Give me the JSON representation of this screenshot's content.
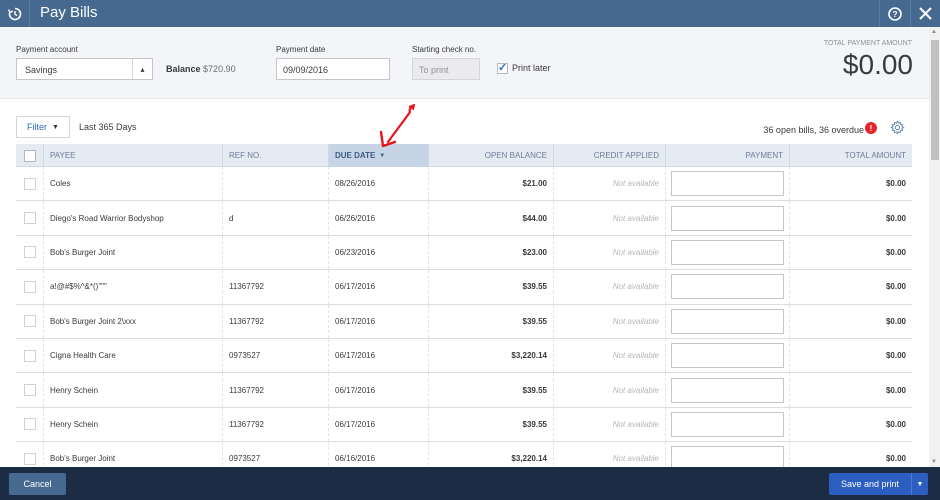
{
  "window": {
    "title": "Pay Bills",
    "icons": {
      "history": "history-icon",
      "help": "help-icon",
      "close": "close-icon"
    }
  },
  "header": {
    "payment_account_label": "Payment account",
    "payment_account_value": "Savings",
    "balance_label": "Balance",
    "balance_value": "$720.90",
    "payment_date_label": "Payment date",
    "payment_date_value": "09/09/2016",
    "starting_check_label": "Starting check no.",
    "starting_check_placeholder": "To print",
    "print_later_label": "Print later",
    "print_later_checked": true,
    "total_payment_label": "TOTAL PAYMENT AMOUNT",
    "total_payment_value": "$0.00"
  },
  "filter": {
    "button_label": "Filter",
    "range_label": "Last 365 Days",
    "summary": "36 open bills, 36 overdue"
  },
  "table": {
    "columns": [
      "PAYEE",
      "REF NO.",
      "DUE DATE",
      "OPEN BALANCE",
      "CREDIT APPLIED",
      "PAYMENT",
      "TOTAL AMOUNT"
    ],
    "sorted_column": "DUE DATE",
    "rows": [
      {
        "payee": "Coles",
        "ref": "",
        "due": "08/26/2016",
        "open": "$21.00",
        "credit": "Not available",
        "payment": "",
        "total": "$0.00"
      },
      {
        "payee": "Diego's Road Warrior Bodyshop",
        "ref": "d",
        "due": "06/26/2016",
        "open": "$44.00",
        "credit": "Not available",
        "payment": "",
        "total": "$0.00"
      },
      {
        "payee": "Bob's Burger Joint",
        "ref": "",
        "due": "06/23/2016",
        "open": "$23.00",
        "credit": "Not available",
        "payment": "",
        "total": "$0.00"
      },
      {
        "payee": "a!@#$%^&*()\"\"\"",
        "ref": "11367792",
        "due": "06/17/2016",
        "open": "$39.55",
        "credit": "Not available",
        "payment": "",
        "total": "$0.00"
      },
      {
        "payee": "Bob's Burger Joint 2\\xxx",
        "ref": "11367792",
        "due": "06/17/2016",
        "open": "$39.55",
        "credit": "Not available",
        "payment": "",
        "total": "$0.00"
      },
      {
        "payee": "Cigna Health Care",
        "ref": "0973527",
        "due": "06/17/2016",
        "open": "$3,220.14",
        "credit": "Not available",
        "payment": "",
        "total": "$0.00"
      },
      {
        "payee": "Henry Schein",
        "ref": "11367792",
        "due": "06/17/2016",
        "open": "$39.55",
        "credit": "Not available",
        "payment": "",
        "total": "$0.00"
      },
      {
        "payee": "Henry Schein",
        "ref": "11367792",
        "due": "06/17/2016",
        "open": "$39.55",
        "credit": "Not available",
        "payment": "",
        "total": "$0.00"
      },
      {
        "payee": "Bob's Burger Joint",
        "ref": "0973527",
        "due": "06/16/2016",
        "open": "$3,220.14",
        "credit": "Not available",
        "payment": "",
        "total": "$0.00"
      }
    ]
  },
  "footer": {
    "cancel_label": "Cancel",
    "save_label": "Save and print"
  },
  "colors": {
    "titlebar": "#466a8f",
    "footer": "#1b2c44",
    "primary_button": "#2c5dc1",
    "alert": "#e3262c",
    "annotation_arrow": "#e8141b"
  }
}
